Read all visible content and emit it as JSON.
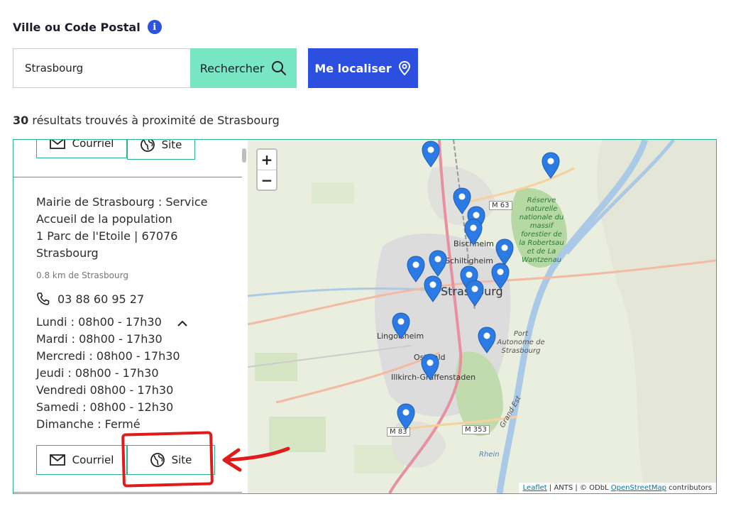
{
  "search": {
    "label": "Ville ou Code Postal",
    "info_icon": "i",
    "value": "Strasbourg",
    "search_button": "Rechercher",
    "locate_button": "Me localiser"
  },
  "results": {
    "count": "30",
    "text": "résultats trouvés à proximité de Strasbourg"
  },
  "card_prev": {
    "email_label": "Courriel",
    "site_label": "Site"
  },
  "card": {
    "name": "Mairie de Strasbourg : Service Accueil de la population",
    "address_line": "1 Parc de l'Etoile  | 67076",
    "city": "Strasbourg",
    "distance": "0.8 km de Strasbourg",
    "phone": "03 88 60 95 27",
    "hours": [
      "Lundi : 08h00 - 17h30",
      "Mardi : 08h00 - 17h30",
      "Mercredi : 08h00 - 17h30",
      "Jeudi : 08h00 - 17h30",
      "Vendredi 08h00 - 17h30",
      "Samedi : 08h00 - 12h30",
      "Dimanche : Fermé"
    ],
    "email_label": "Courriel",
    "site_label": "Site"
  },
  "map": {
    "zoom_in": "+",
    "zoom_out": "−",
    "places": {
      "strasbourg": "Strasbourg",
      "bischheim": "Bischheim",
      "schiltigheim": "Schiltigheim",
      "lingolsheim": "Lingolsheim",
      "ostwald": "Ostwald",
      "illkirch": "Illkirch-Graffenstaden",
      "reserve": "Réserve naturelle nationale du massif forestier de la Robertsau et de La Wantzenau",
      "port": "Port Autonome de Strasbourg",
      "rhein": "Rhein",
      "grand_est": "Grand Est"
    },
    "roads": {
      "m63": "M 63",
      "m83": "M 83",
      "m353": "M 353"
    },
    "attribution": {
      "leaflet": "Leaflet",
      "ants": " | ANTS | © ODbL ",
      "osm": "OpenStreetMap",
      "contributors": " contributors"
    }
  },
  "colors": {
    "accent_green": "#2ab58d",
    "search_button": "#78e6c2",
    "locate_button": "#2c4fe0",
    "marker": "#2c7be5",
    "annotation": "#e01b1b"
  }
}
